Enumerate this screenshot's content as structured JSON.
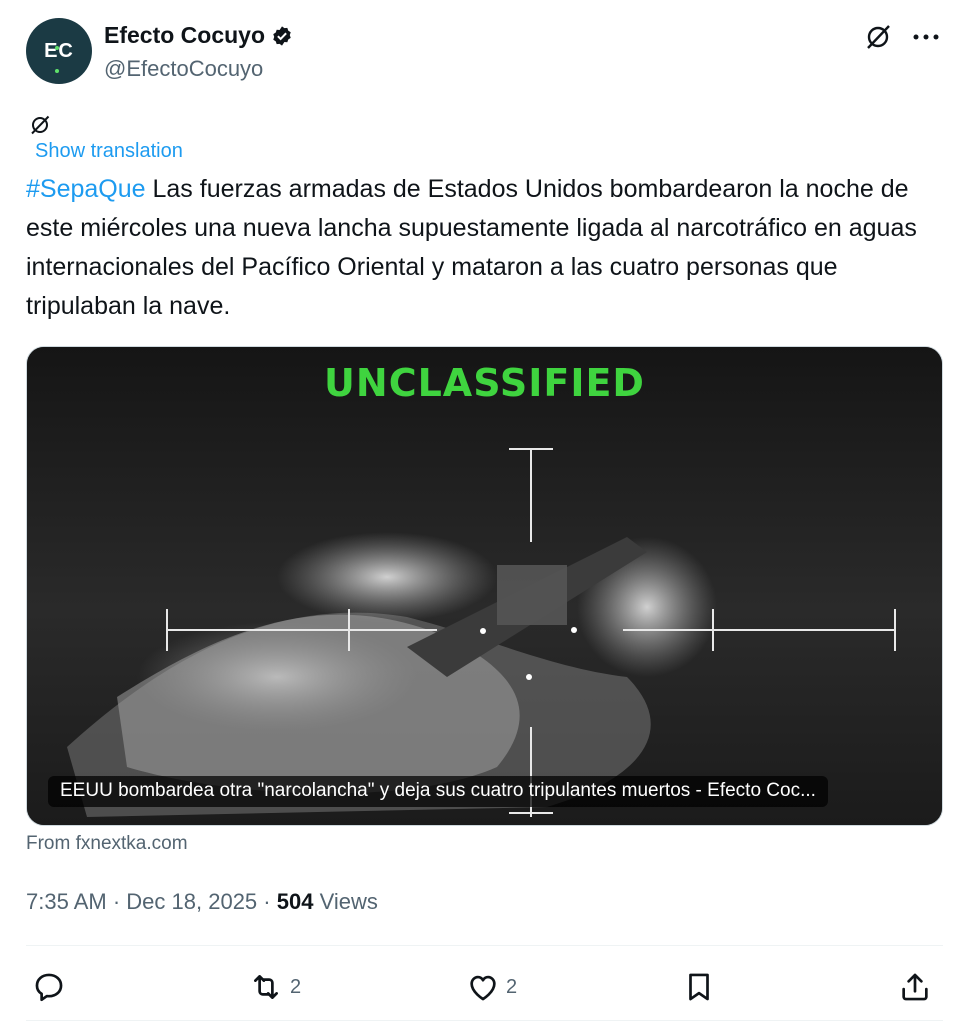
{
  "account": {
    "avatar_initials": "EC",
    "display_name": "Efecto Cocuyo",
    "handle": "@EfectoCocuyo",
    "verified": true
  },
  "header_icons": [
    "grok-icon",
    "more-icon"
  ],
  "show_translation_label": "Show translation",
  "tweet": {
    "hashtag": "#SepaQue",
    "body": " Las fuerzas armadas de Estados Unidos bombardearon la noche de este miércoles una nueva lancha supuestamente ligada al narcotráfico en aguas internacionales del Pacífico Oriental y mataron a las cuatro personas que tripulaban la nave."
  },
  "media": {
    "overlay_text": "UNCLASSIFIED",
    "caption": "EEUU bombardea otra \"narcolancha\" y deja sus cuatro tripulantes muertos - Efecto Coc...",
    "source": "From fxnextka.com"
  },
  "meta": {
    "time": "7:35 AM",
    "date": "Dec 18, 2025",
    "views_count": "504",
    "views_label": "Views"
  },
  "actions": {
    "reply_count": "",
    "retweet_count": "2",
    "like_count": "2"
  },
  "colors": {
    "link": "#1d9bf0",
    "secondary_text": "#536471",
    "overlay_green": "#3fd43f",
    "avatar_bg": "#1b3a44"
  }
}
